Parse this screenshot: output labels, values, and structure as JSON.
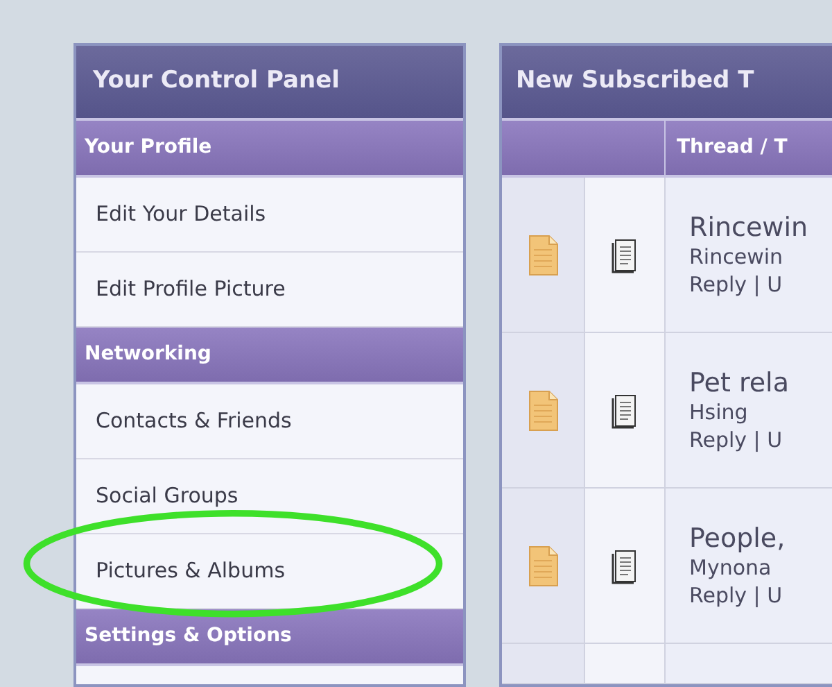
{
  "control_panel": {
    "title": "Your Control Panel",
    "sections": [
      {
        "heading": "Your Profile",
        "items": [
          {
            "label": "Edit Your Details",
            "circled": false
          },
          {
            "label": "Edit Profile Picture",
            "circled": false
          }
        ]
      },
      {
        "heading": "Networking",
        "items": [
          {
            "label": "Contacts & Friends",
            "circled": false
          },
          {
            "label": "Social Groups",
            "circled": false
          },
          {
            "label": "Pictures & Albums",
            "circled": true
          }
        ]
      },
      {
        "heading": "Settings & Options"
      }
    ]
  },
  "threads_panel": {
    "title": "New Subscribed T",
    "column_header": "Thread / T",
    "rows": [
      {
        "title": "Rincewin",
        "author": "Rincewin",
        "actions": "Reply | U"
      },
      {
        "title": "Pet rela",
        "author": "Hsing",
        "actions": "Reply | U"
      },
      {
        "title": "People,",
        "author": "Mynona",
        "actions": "Reply | U"
      },
      {
        "kind": "cut_off"
      }
    ]
  }
}
